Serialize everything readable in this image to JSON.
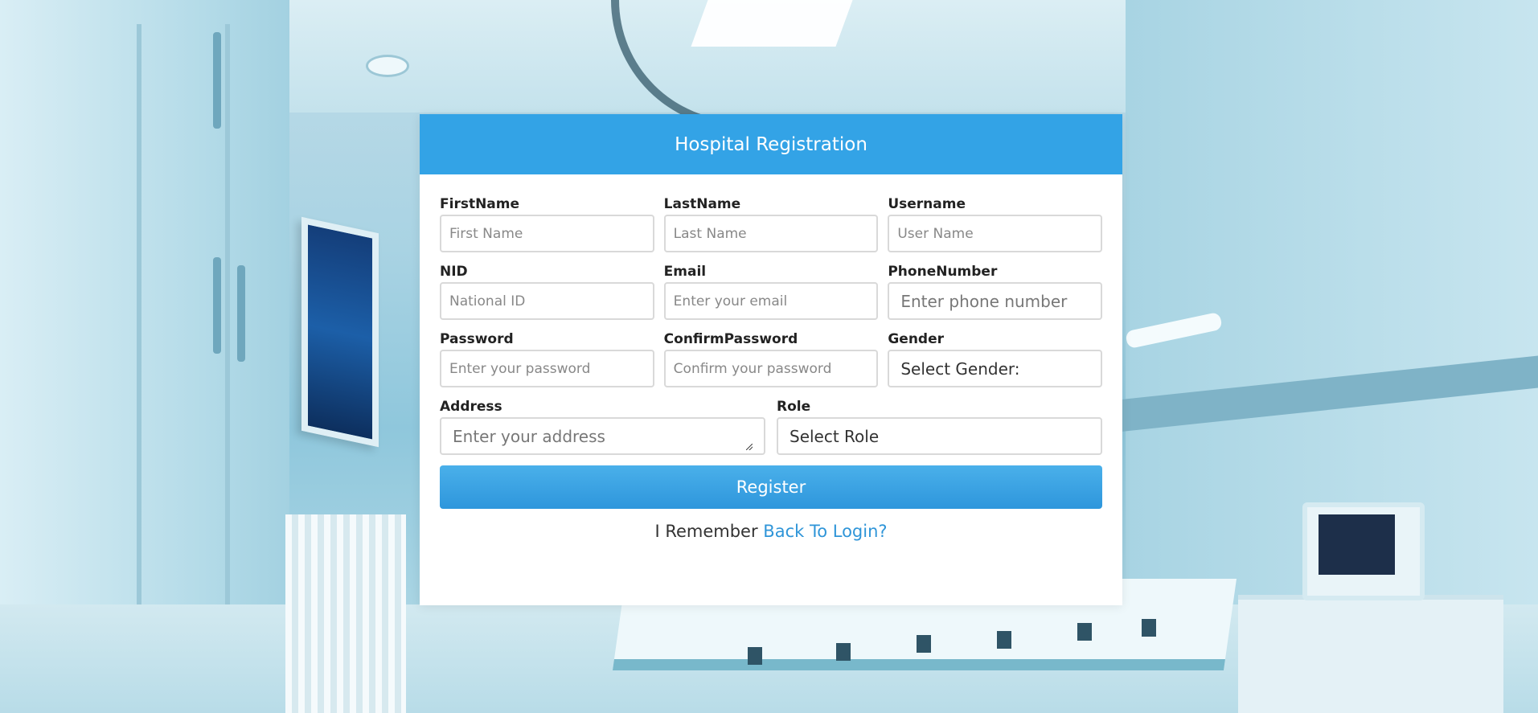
{
  "header": {
    "title": "Hospital Registration"
  },
  "fields": {
    "firstname": {
      "label": "FirstName",
      "placeholder": "First Name"
    },
    "lastname": {
      "label": "LastName",
      "placeholder": "Last Name"
    },
    "username": {
      "label": "Username",
      "placeholder": "User Name"
    },
    "nid": {
      "label": "NID",
      "placeholder": "National ID"
    },
    "email": {
      "label": "Email",
      "placeholder": "Enter your email"
    },
    "phone": {
      "label": "PhoneNumber",
      "placeholder": "Enter phone number"
    },
    "password": {
      "label": "Password",
      "placeholder": "Enter your password"
    },
    "confirm_password": {
      "label": "ConfirmPassword",
      "placeholder": "Confirm your password"
    },
    "gender": {
      "label": "Gender",
      "selected": "Select Gender:"
    },
    "address": {
      "label": "Address",
      "placeholder": "Enter your address"
    },
    "role": {
      "label": "Role",
      "selected": "Select Role"
    }
  },
  "actions": {
    "register_label": "Register"
  },
  "footer": {
    "prefix": "I Remember",
    "link": "Back To Login?"
  },
  "colors": {
    "accent": "#33a3e6",
    "link": "#2f95d8"
  }
}
